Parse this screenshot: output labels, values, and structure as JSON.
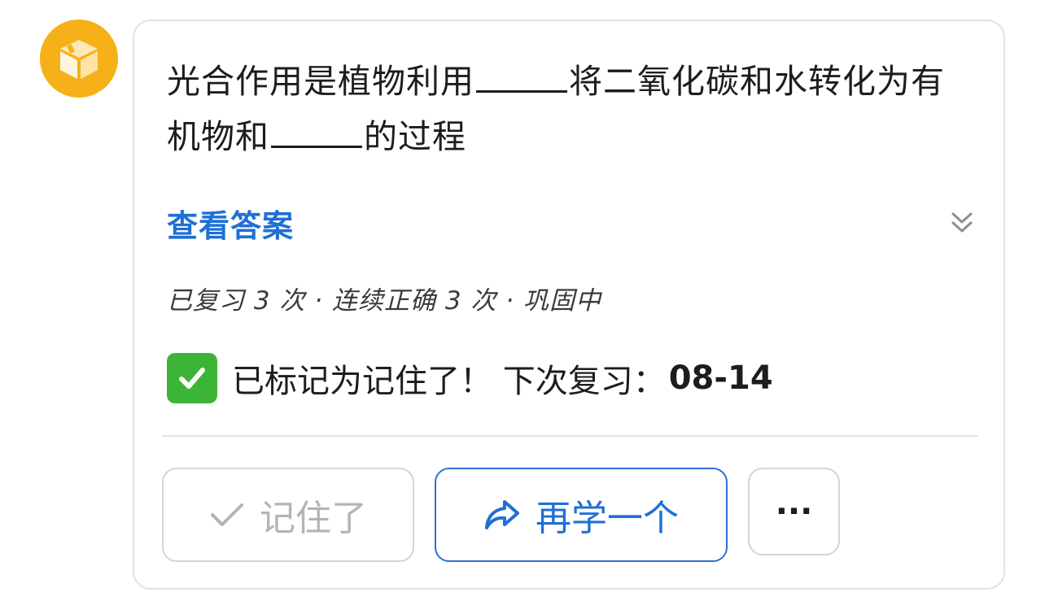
{
  "avatar": {
    "icon": "box-icon",
    "color": "#f7b118"
  },
  "card": {
    "question_part1": "光合作用是植物利用",
    "question_part2": "将二氧化碳和水转化为有机物和",
    "question_part3": "的过程",
    "answer_toggle": {
      "label": "查看答案",
      "icon": "chevron-double-down-icon"
    },
    "stats": "已复习 3 次 · 连续正确 3 次 · 巩固中",
    "status": {
      "icon": "check-mark-button-icon",
      "text": "已标记为记住了！ 下次复习：",
      "next_review_date": "08-14"
    },
    "actions": {
      "remembered": {
        "label": "记住了",
        "icon": "check-icon",
        "disabled": true
      },
      "learn_another": {
        "label": "再学一个",
        "icon": "share-arrow-icon"
      },
      "more": {
        "label": "···",
        "icon": "more-icon"
      }
    }
  },
  "colors": {
    "accent": "#1f6fd6",
    "success": "#3cb435",
    "border": "#e2e2e6"
  }
}
